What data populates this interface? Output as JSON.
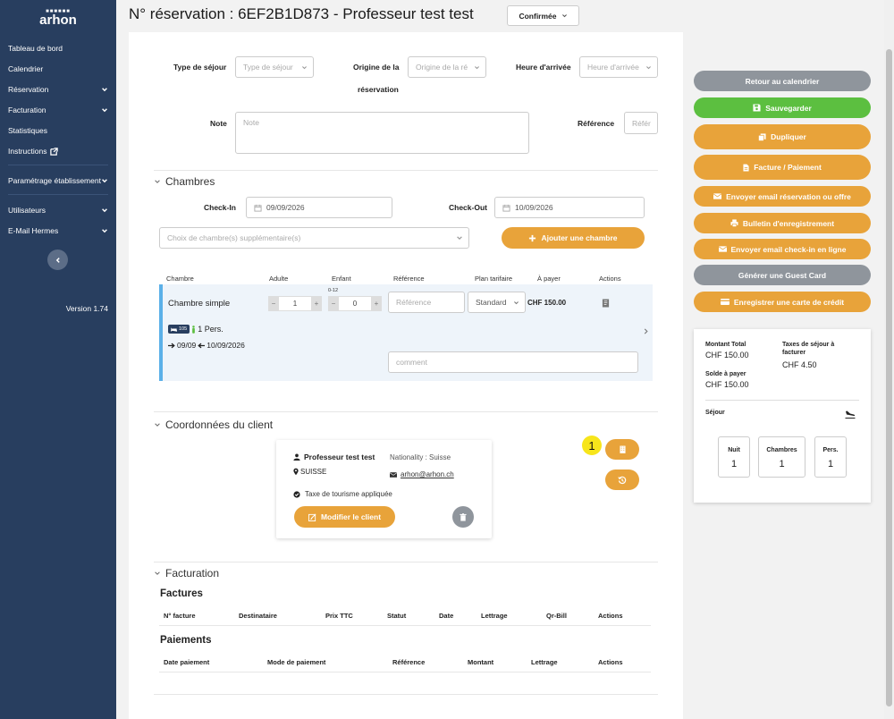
{
  "sidebar": {
    "logo_top": "■■■■■■",
    "logo_main": "arhon",
    "items": [
      {
        "label": "Tableau de bord"
      },
      {
        "label": "Calendrier"
      },
      {
        "label": "Réservation"
      },
      {
        "label": "Facturation"
      },
      {
        "label": "Statistiques"
      },
      {
        "label": "Instructions"
      },
      {
        "label": "Paramétrage établissement"
      },
      {
        "label": "Utilisateurs"
      },
      {
        "label": "E-Mail Hermes"
      }
    ],
    "version": "Version 1.74"
  },
  "header": {
    "title": "N° réservation : 6EF2B1D873 - Professeur test test",
    "status": "Confirmée"
  },
  "form": {
    "type_sejour_label": "Type de séjour",
    "type_sejour_placeholder": "Type de séjour",
    "origine_label_1": "Origine de la",
    "origine_label_2": "réservation",
    "origine_placeholder": "Origine de la ré",
    "heure_label": "Heure d'arrivée",
    "heure_placeholder": "Heure d'arrivée",
    "note_label": "Note",
    "note_placeholder": "Note",
    "reference_label": "Référence",
    "reference_placeholder": "Référ"
  },
  "chambres": {
    "title": "Chambres",
    "checkin_label": "Check-In",
    "checkin_value": "09/09/2026",
    "checkout_label": "Check-Out",
    "checkout_value": "10/09/2026",
    "choix_placeholder": "Choix de chambre(s) supplémentaire(s)",
    "add_button": "Ajouter une chambre",
    "columns": [
      "Chambre",
      "Adulte",
      "Enfant",
      "Référence",
      "Plan tarifaire",
      "À payer",
      "Actions"
    ],
    "row": {
      "name": "Chambre simple",
      "adulte": "1",
      "enfant_age": "0-12",
      "enfant": "0",
      "reference_placeholder": "Référence",
      "plan": "Standard",
      "a_payer": "CHF 150.00",
      "room_number": "105",
      "persons": "1 Pers.",
      "dates": "09/09",
      "dates_to": "10/09/2026",
      "comment_placeholder": "comment"
    }
  },
  "client": {
    "title": "Coordonnées du client",
    "name": "Professeur  test test",
    "nationality": "Nationality : Suisse",
    "country": "SUISSE",
    "email": "arhon@arhon.ch",
    "tax_note": "Taxe de tourisme appliquée",
    "edit_button": "Modifier le client",
    "badge": "1"
  },
  "facturation": {
    "title": "Facturation",
    "factures_title": "Factures",
    "factures_columns": [
      "N° facture",
      "Destinataire",
      "Prix TTC",
      "Statut",
      "Date",
      "Lettrage",
      "Qr-Bill",
      "Actions"
    ],
    "paiements_title": "Paiements",
    "paiements_columns": [
      "Date paiement",
      "Mode de paiement",
      "Référence",
      "Montant",
      "Lettrage",
      "Actions"
    ]
  },
  "actions": {
    "retour": "Retour au calendrier",
    "sauvegarder": "Sauvegarder",
    "dupliquer": "Dupliquer",
    "facture": "Facture / Paiement",
    "email_resa": "Envoyer email réservation ou offre",
    "bulletin": "Bulletin d'enregistrement",
    "email_checkin": "Envoyer email check-in en ligne",
    "guest_card": "Générer une Guest Card",
    "carte_credit": "Enregistrer une carte de crédit"
  },
  "summary": {
    "montant_label": "Montant Total",
    "montant_value": "CHF 150.00",
    "taxes_label_1": "Taxes de séjour à",
    "taxes_label_2": "facturer",
    "taxes_value": "CHF 4.50",
    "solde_label": "Solde à payer",
    "solde_value": "CHF 150.00",
    "sejour_label": "Séjour",
    "nuit_label": "Nuit",
    "nuit_value": "1",
    "chambres_label": "Chambres",
    "chambres_value": "1",
    "pers_label": "Pers.",
    "pers_value": "1"
  },
  "colors": {
    "sidebar": "#283e5f",
    "orange": "#e8a33a",
    "green": "#5cbf40",
    "gray": "#8f959c",
    "room_accent": "#5bb0e8"
  }
}
